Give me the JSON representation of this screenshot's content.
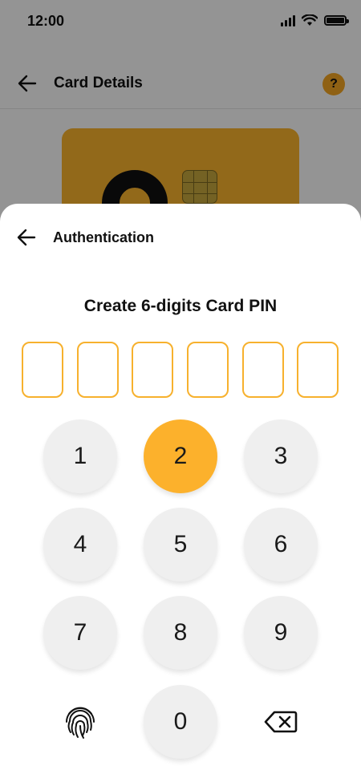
{
  "status_bar": {
    "time": "12:00"
  },
  "background_screen": {
    "header": {
      "title": "Card Details",
      "help_label": "?"
    }
  },
  "sheet": {
    "title": "Authentication",
    "heading": "Create 6-digits Card PIN",
    "pin_length": 6
  },
  "keypad": {
    "keys": [
      "1",
      "2",
      "3",
      "4",
      "5",
      "6",
      "7",
      "8",
      "9",
      "0"
    ],
    "active_key": "2"
  },
  "colors": {
    "accent": "#fcb12c",
    "key_background": "#efefef",
    "overlay": "rgba(0,0,0,0.42)"
  },
  "icons": {
    "back": "arrow-left-icon",
    "help": "question-icon",
    "biometric": "fingerprint-icon",
    "delete": "backspace-icon"
  }
}
